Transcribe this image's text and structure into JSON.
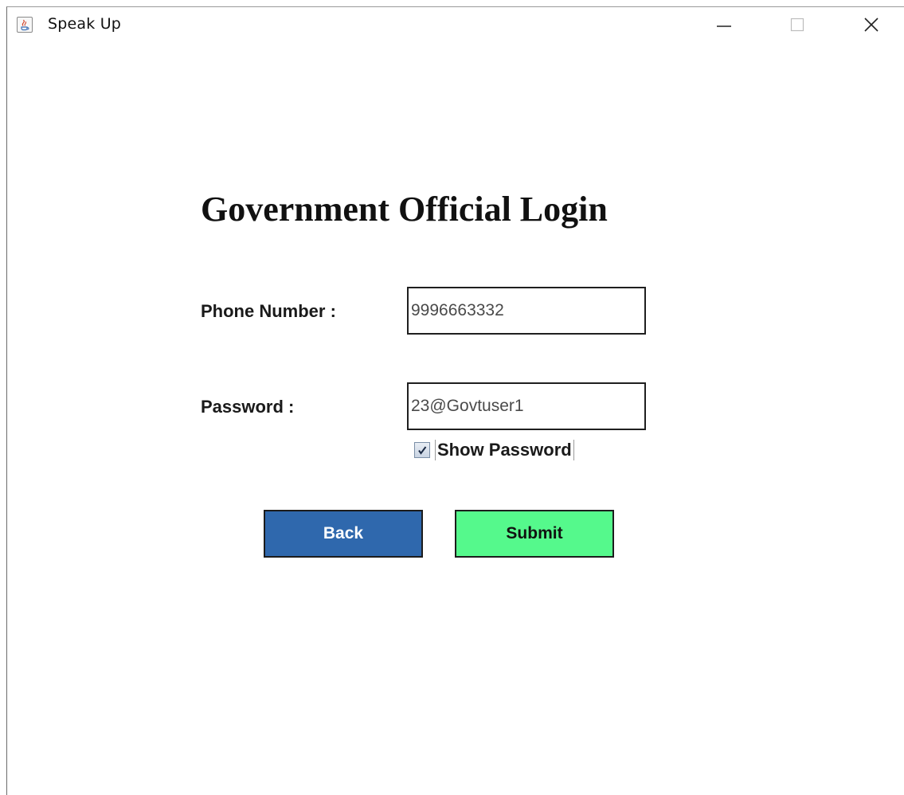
{
  "window": {
    "title": "Speak Up",
    "icon": "java-coffee-cup-icon",
    "controls": {
      "minimize": "minimize-icon",
      "maximize": "maximize-icon",
      "close": "close-icon"
    }
  },
  "form": {
    "heading": "Government Official Login",
    "phone": {
      "label": "Phone Number  :",
      "value": "9996663332"
    },
    "password": {
      "label": "Password  :",
      "value": "23@Govtuser1"
    },
    "show_password": {
      "label": "Show Password",
      "checked": true
    }
  },
  "buttons": {
    "back_label": "Back",
    "submit_label": "Submit"
  },
  "colors": {
    "back_button": "#2f68ad",
    "submit_button": "#55f98c"
  }
}
